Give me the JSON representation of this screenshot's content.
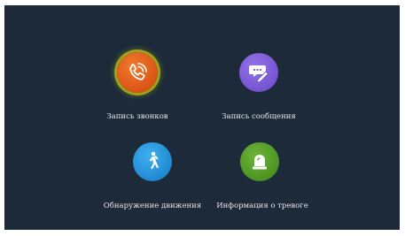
{
  "menu": {
    "items": [
      {
        "label": "Запись звонков",
        "icon": "phone-icon",
        "color": "#e2561b",
        "selected": true
      },
      {
        "label": "Запись сообщения",
        "icon": "message-pencil-icon",
        "color": "#7a58d6",
        "selected": false
      },
      {
        "label": "Обнаружение движения",
        "icon": "walking-person-icon",
        "color": "#1e8fd8",
        "selected": false
      },
      {
        "label": "Информация о тревоге",
        "icon": "alarm-light-icon",
        "color": "#4f9a22",
        "selected": false
      }
    ]
  },
  "colors": {
    "background": "#1d2a39",
    "selection_ring": "#9aa41a"
  }
}
